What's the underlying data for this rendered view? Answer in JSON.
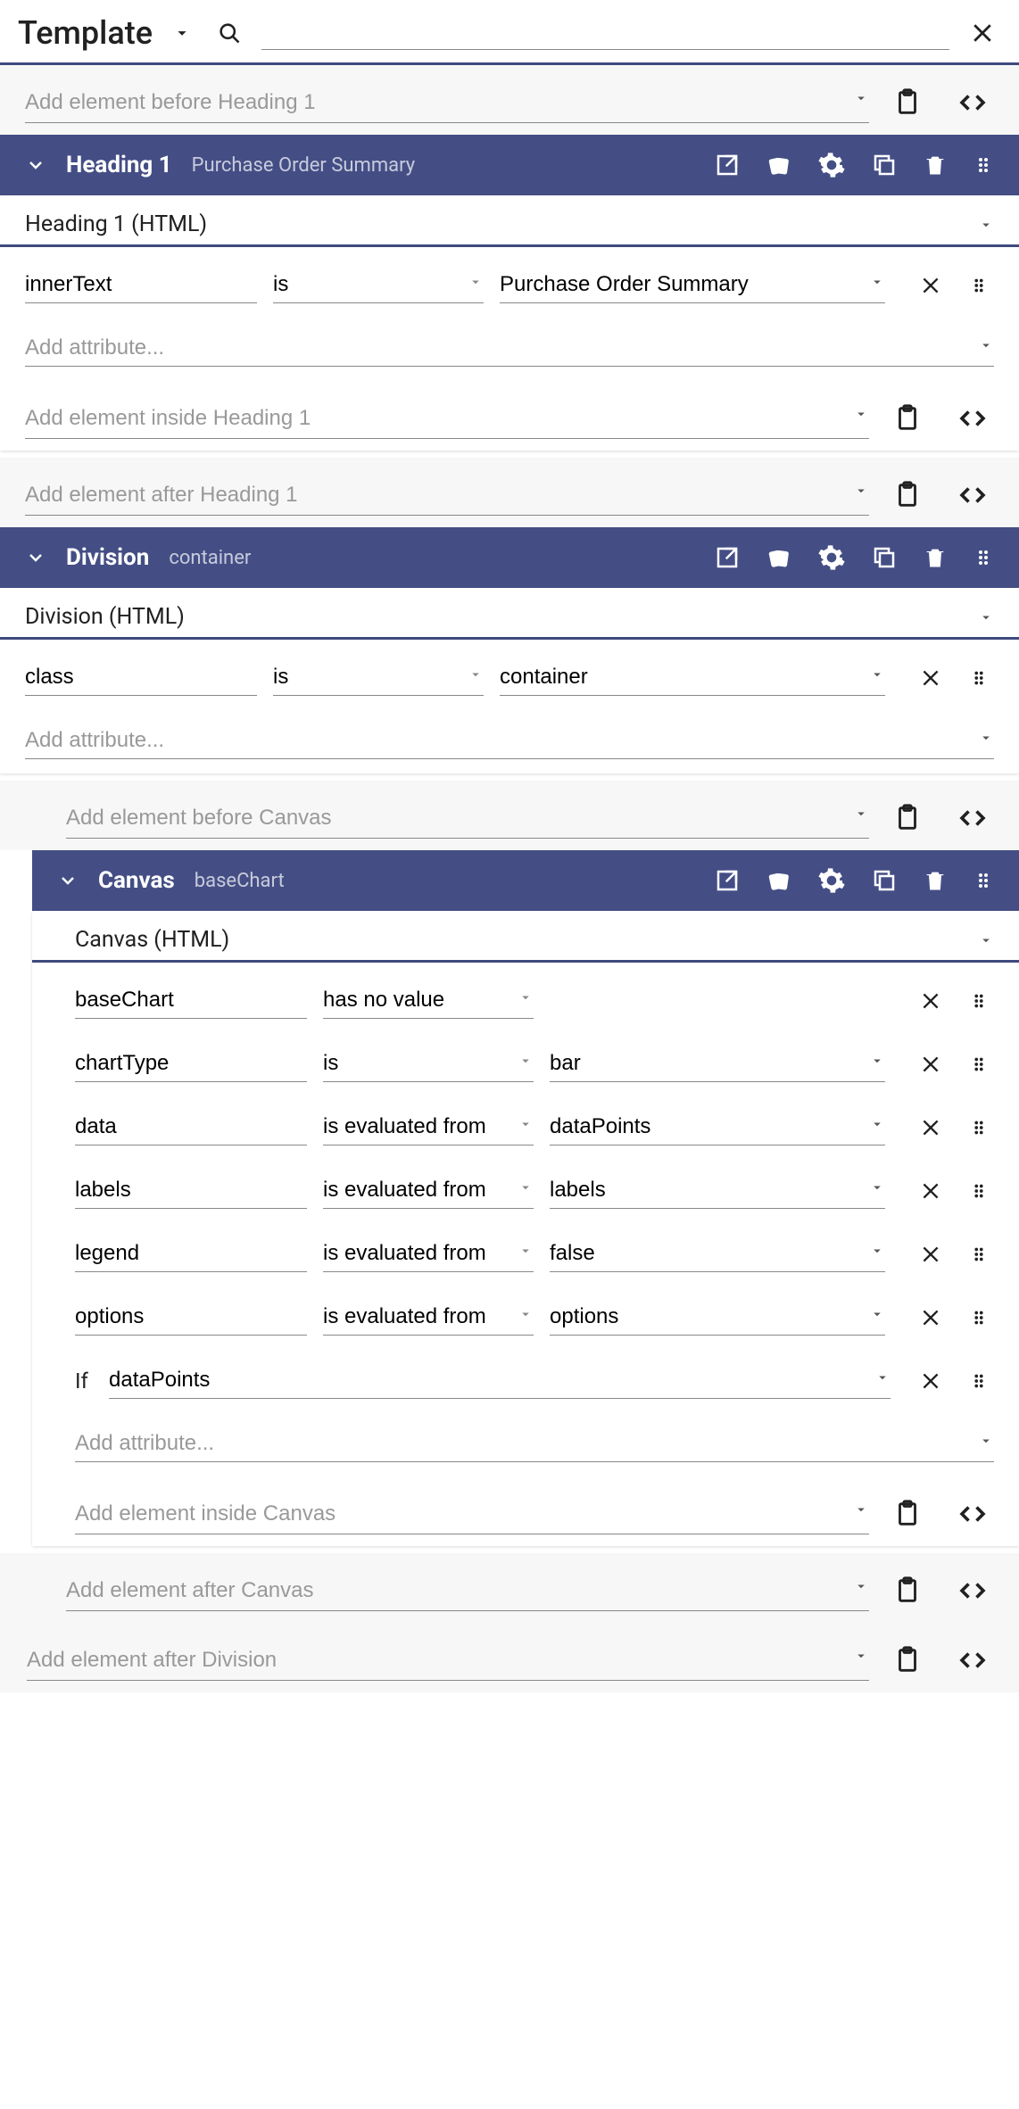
{
  "header": {
    "title": "Template"
  },
  "add_before_h1": {
    "placeholder": "Add element before Heading 1"
  },
  "heading1": {
    "title": "Heading 1",
    "subtitle": "Purchase Order Summary",
    "type_label": "Heading 1 (HTML)",
    "attrs": [
      {
        "name": "innerText",
        "op": "is",
        "value": "Purchase Order Summary"
      }
    ],
    "add_attr_placeholder": "Add attribute...",
    "add_inside_placeholder": "Add element inside Heading 1"
  },
  "add_after_h1": {
    "placeholder": "Add element after Heading 1"
  },
  "division": {
    "title": "Division",
    "subtitle": "container",
    "type_label": "Division (HTML)",
    "attrs": [
      {
        "name": "class",
        "op": "is",
        "value": "container"
      }
    ],
    "add_attr_placeholder": "Add attribute..."
  },
  "add_before_canvas": {
    "placeholder": "Add element before Canvas"
  },
  "canvas": {
    "title": "Canvas",
    "subtitle": "baseChart",
    "type_label": "Canvas (HTML)",
    "attrs": [
      {
        "name": "baseChart",
        "op": "has no value",
        "value": ""
      },
      {
        "name": "chartType",
        "op": "is",
        "value": "bar"
      },
      {
        "name": "data",
        "op": "is evaluated from",
        "value": "dataPoints"
      },
      {
        "name": "labels",
        "op": "is evaluated from",
        "value": "labels"
      },
      {
        "name": "legend",
        "op": "is evaluated from",
        "value": "false"
      },
      {
        "name": "options",
        "op": "is evaluated from",
        "value": "options"
      }
    ],
    "if_label": "If",
    "if_value": "dataPoints",
    "add_attr_placeholder": "Add attribute...",
    "add_inside_placeholder": "Add element inside Canvas"
  },
  "add_after_canvas": {
    "placeholder": "Add element after Canvas"
  },
  "add_after_division": {
    "placeholder": "Add element after Division"
  }
}
